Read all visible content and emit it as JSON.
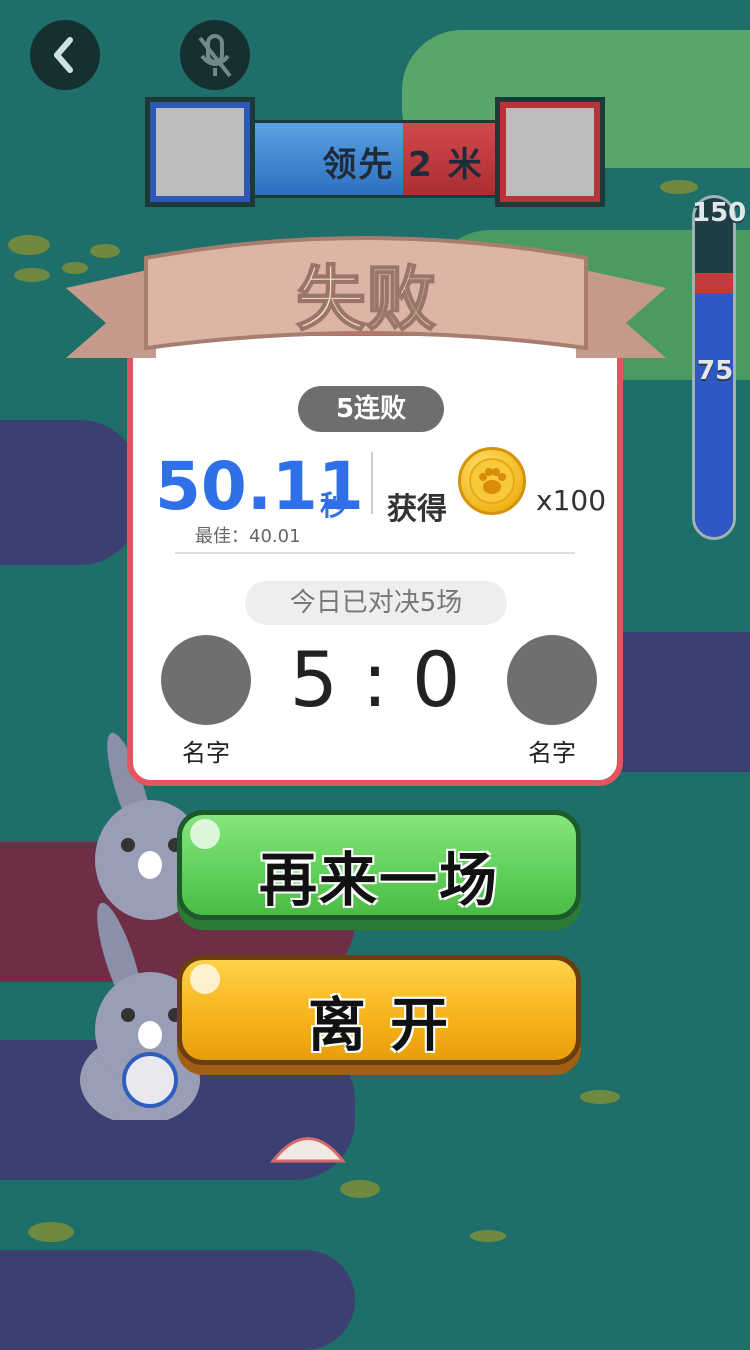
{
  "header": {
    "back_icon": "chevron-left-icon",
    "mic_icon": "mic-off-icon"
  },
  "scorebar": {
    "text": "领先 2 米",
    "left_color": "#2f6fbe",
    "right_color": "#a82e32"
  },
  "meter": {
    "max_label": "150",
    "mid_label": "75",
    "progress": 0.72
  },
  "result": {
    "title": "失败",
    "streak": "5连败",
    "time_value": "50.11",
    "time_unit": "秒",
    "best": "最佳：40.01",
    "earn_label": "获得",
    "coin_icon": "paw-coin-icon",
    "earn_amount": "x100",
    "today": "今日已对决5场",
    "score": "5 : 0",
    "left_name": "名字",
    "right_name": "名字"
  },
  "actions": {
    "retry": "再来一场",
    "leave": "离 开"
  },
  "colors": {
    "time_blue": "#2f6fe8",
    "card_border": "#e25560",
    "background": "#1e6f69"
  }
}
